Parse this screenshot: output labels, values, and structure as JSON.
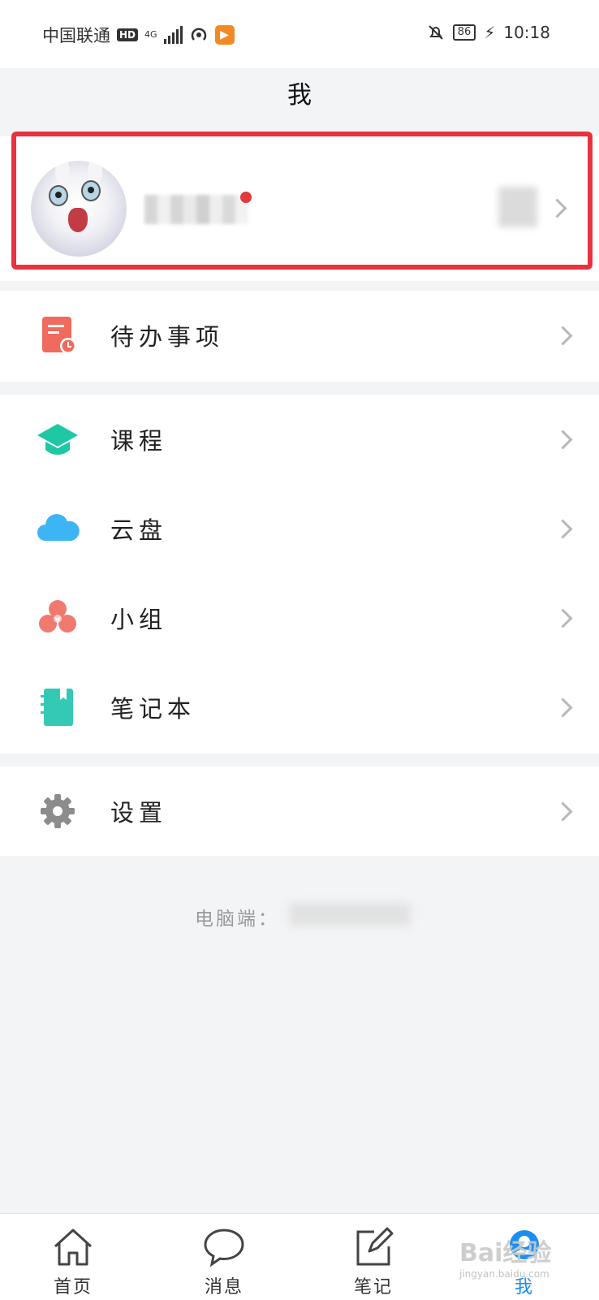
{
  "status_bar": {
    "carrier": "中国联通",
    "hd_badge": "HD",
    "network": "4G",
    "battery": "86",
    "time": "10:18"
  },
  "page": {
    "title": "我"
  },
  "menu": {
    "todo": "待办事项",
    "courses": "课程",
    "cloud_disk": "云盘",
    "groups": "小组",
    "notebook": "笔记本",
    "settings": "设置"
  },
  "footer": {
    "desktop_label": "电脑端："
  },
  "tabs": [
    {
      "label": "首页",
      "icon": "home-icon"
    },
    {
      "label": "消息",
      "icon": "chat-bubble-icon"
    },
    {
      "label": "笔记",
      "icon": "note-edit-icon"
    },
    {
      "label": "我",
      "icon": "me-icon",
      "active": true
    }
  ],
  "watermark": {
    "text": "Bai经验",
    "sub": "jingyan.baidu.com"
  },
  "colors": {
    "highlight_frame": "#e8323f",
    "accent_blue": "#1b8ef0",
    "todo_icon": "#f06a5d",
    "course_icon": "#1ec8a5",
    "cloud_icon": "#3db4f4",
    "group_icon": "#f07a70",
    "notebook_icon": "#34c9b4",
    "settings_icon": "#8c8c8c"
  }
}
